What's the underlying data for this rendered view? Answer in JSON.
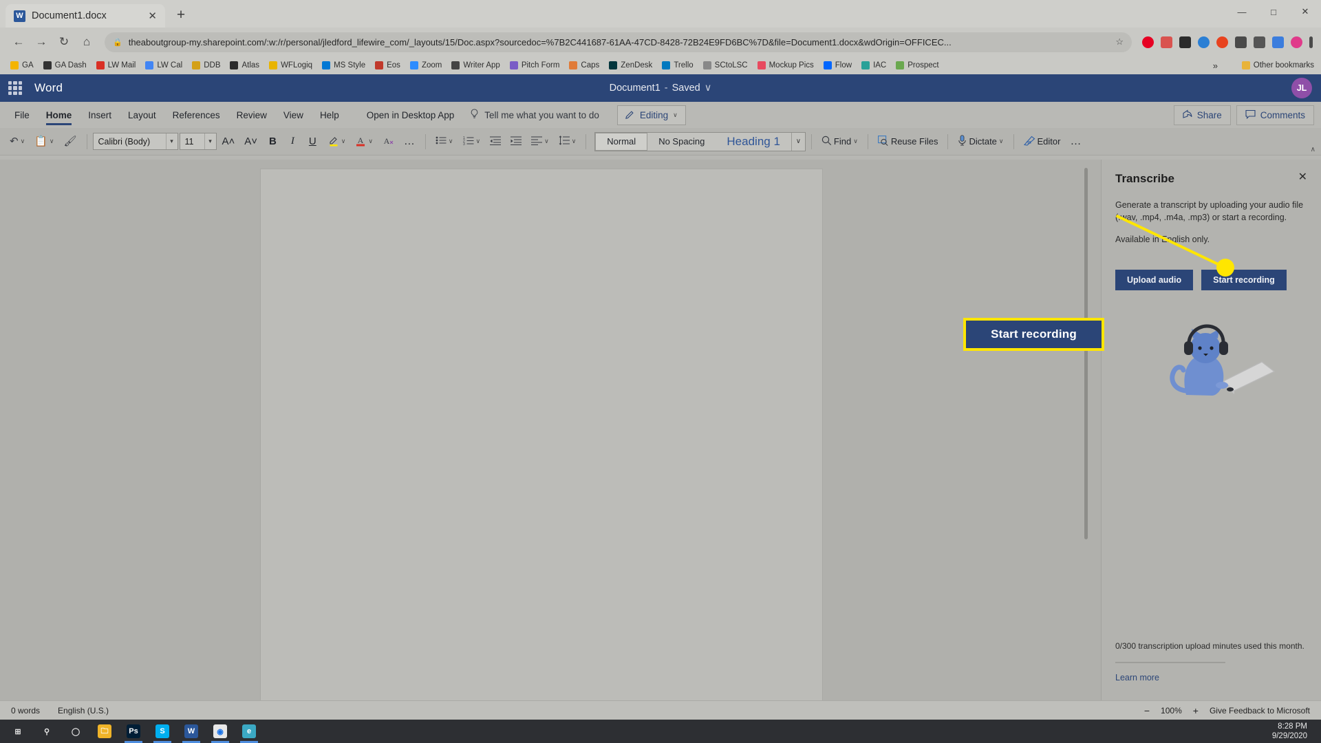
{
  "browser": {
    "tab": {
      "title": "Document1.docx",
      "favicon": "word-favicon",
      "close": "✕"
    },
    "newtab_label": "+",
    "window_controls": {
      "minimize": "—",
      "maximize": "□",
      "close": "✕"
    },
    "nav": {
      "back": "←",
      "forward": "→",
      "reload": "↻",
      "home": "⌂"
    },
    "omnibox": {
      "lock": "🔒",
      "url": "theaboutgroup-my.sharepoint.com/:w:/r/personal/jledford_lifewire_com/_layouts/15/Doc.aspx?sourcedoc=%7B2C441687-61AA-47CD-8428-72B24E9FD6BC%7D&file=Document1.docx&wdOrigin=OFFICEC...",
      "star": "☆"
    },
    "extensions": [
      "pinterest-ext",
      "grammarly-ext",
      "adblock-ext",
      "lastpass-ext",
      "honey-ext",
      "note-ext",
      "camera-ext",
      "translate-ext",
      "color-ext",
      "menu-ext"
    ],
    "bookmarks": [
      {
        "label": "GA",
        "color": "#f4b400"
      },
      {
        "label": "GA Dash",
        "color": "#333333"
      },
      {
        "label": "LW Mail",
        "color": "#d93025"
      },
      {
        "label": "LW Cal",
        "color": "#4285f4"
      },
      {
        "label": "DDB",
        "color": "#d4a017"
      },
      {
        "label": "Atlas",
        "color": "#2b2b2b"
      },
      {
        "label": "WFLogiq",
        "color": "#e8b400"
      },
      {
        "label": "MS Style",
        "color": "#0078d4"
      },
      {
        "label": "Eos",
        "color": "#c0392b"
      },
      {
        "label": "Zoom",
        "color": "#2d8cff"
      },
      {
        "label": "Writer App",
        "color": "#444444"
      },
      {
        "label": "Pitch Form",
        "color": "#7a5cc6"
      },
      {
        "label": "Caps",
        "color": "#e07b39"
      },
      {
        "label": "ZenDesk",
        "color": "#03363d"
      },
      {
        "label": "Trello",
        "color": "#0079bf"
      },
      {
        "label": "SCtoLSC",
        "color": "#888888"
      },
      {
        "label": "Mockup Pics",
        "color": "#e84a5f"
      },
      {
        "label": "Flow",
        "color": "#0066ff"
      },
      {
        "label": "IAC",
        "color": "#2aa198"
      },
      {
        "label": "Prospect",
        "color": "#6aa84f"
      }
    ],
    "bookmarks_overflow": "»",
    "other_bookmarks": {
      "label": "Other bookmarks",
      "icon": "folder-icon"
    }
  },
  "word": {
    "waffle_label": "app-launcher",
    "brand": "Word",
    "doc_name": "Document1",
    "doc_sep": "-",
    "doc_status": "Saved",
    "doc_status_caret": "∨",
    "avatar_initials": "JL",
    "menu": [
      {
        "label": "File",
        "active": false
      },
      {
        "label": "Home",
        "active": true
      },
      {
        "label": "Insert",
        "active": false
      },
      {
        "label": "Layout",
        "active": false
      },
      {
        "label": "References",
        "active": false
      },
      {
        "label": "Review",
        "active": false
      },
      {
        "label": "View",
        "active": false
      },
      {
        "label": "Help",
        "active": false
      }
    ],
    "open_desktop": "Open in Desktop App",
    "tellme": {
      "icon": "lightbulb-icon",
      "placeholder": "Tell me what you want to do"
    },
    "editing": {
      "icon": "pencil-icon",
      "label": "Editing",
      "caret": "∨"
    },
    "share": {
      "icon": "share-icon",
      "label": "Share"
    },
    "comments": {
      "icon": "comment-icon",
      "label": "Comments"
    },
    "ribbon": {
      "undo": {
        "icon": "undo-icon",
        "caret": "∨"
      },
      "paste": {
        "icon": "clipboard-icon",
        "caret": "∨"
      },
      "format_painter": {
        "icon": "format-painter-icon"
      },
      "font_name": "Calibri (Body)",
      "font_size": "11",
      "grow_font": "A˄",
      "shrink_font": "A˅",
      "bold": "B",
      "italic": "I",
      "underline": "U",
      "highlight": {
        "icon": "highlight-icon",
        "caret": "∨",
        "color": "#ffe600"
      },
      "font_color": {
        "icon": "font-color-icon",
        "caret": "∨",
        "color": "#d93025"
      },
      "clear_format": {
        "icon": "clear-formatting-icon"
      },
      "font_more": "…",
      "bullets": {
        "icon": "bullet-list-icon",
        "caret": "∨"
      },
      "numbering": {
        "icon": "numbered-list-icon",
        "caret": "∨"
      },
      "decrease_indent": {
        "icon": "decrease-indent-icon"
      },
      "increase_indent": {
        "icon": "increase-indent-icon"
      },
      "align": {
        "icon": "align-left-icon",
        "caret": "∨"
      },
      "line_spacing": {
        "icon": "line-spacing-icon",
        "caret": "∨"
      },
      "styles": [
        {
          "label": "Normal",
          "selected": true
        },
        {
          "label": "No Spacing",
          "selected": false
        },
        {
          "label": "Heading 1",
          "selected": false
        }
      ],
      "styles_more": "∨",
      "find": {
        "icon": "search-icon",
        "label": "Find",
        "caret": "∨"
      },
      "reuse_files": {
        "icon": "reuse-files-icon",
        "label": "Reuse Files"
      },
      "dictate": {
        "icon": "microphone-icon",
        "label": "Dictate",
        "caret": "∨"
      },
      "editor": {
        "icon": "editor-icon",
        "label": "Editor"
      },
      "more": "…",
      "collapse": "∧"
    }
  },
  "transcribe": {
    "title": "Transcribe",
    "close": "✕",
    "description": "Generate a transcript by uploading your audio file (.wav, .mp4, .m4a, .mp3) or start a recording.",
    "note": "Available in English only.",
    "upload_button": "Upload audio",
    "record_button": "Start recording",
    "illustration": "cat-with-headphones-laptop-illustration",
    "usage": "0/300 transcription upload minutes used this month.",
    "learn_more": "Learn more"
  },
  "callout": {
    "label": "Start recording",
    "border_color": "#ffe600",
    "fill_color": "#2b4577"
  },
  "statusbar": {
    "word_count": "0 words",
    "language": "English (U.S.)",
    "zoom_out": "−",
    "zoom_level": "100%",
    "zoom_in": "+",
    "feedback": "Give Feedback to Microsoft"
  },
  "taskbar": {
    "items": [
      {
        "name": "start-button",
        "glyph": "⊞",
        "color": "transparent",
        "running": false
      },
      {
        "name": "search-icon",
        "glyph": "⚲",
        "color": "transparent",
        "running": false
      },
      {
        "name": "task-view-icon",
        "glyph": "◯",
        "color": "transparent",
        "running": false
      },
      {
        "name": "file-explorer",
        "glyph": "🗀",
        "color": "#f0b429",
        "running": false
      },
      {
        "name": "photoshop",
        "glyph": "Ps",
        "color": "#001e36",
        "running": true
      },
      {
        "name": "skype",
        "glyph": "S",
        "color": "#00aff0",
        "running": true
      },
      {
        "name": "word-app",
        "glyph": "W",
        "color": "#2b579a",
        "running": true
      },
      {
        "name": "chrome",
        "glyph": "◉",
        "color": "#e8e8e8",
        "running": true
      },
      {
        "name": "edge-legacy",
        "glyph": "e",
        "color": "#3ba9c4",
        "running": true
      }
    ],
    "clock_time": "8:28 PM",
    "clock_date": "9/29/2020"
  }
}
